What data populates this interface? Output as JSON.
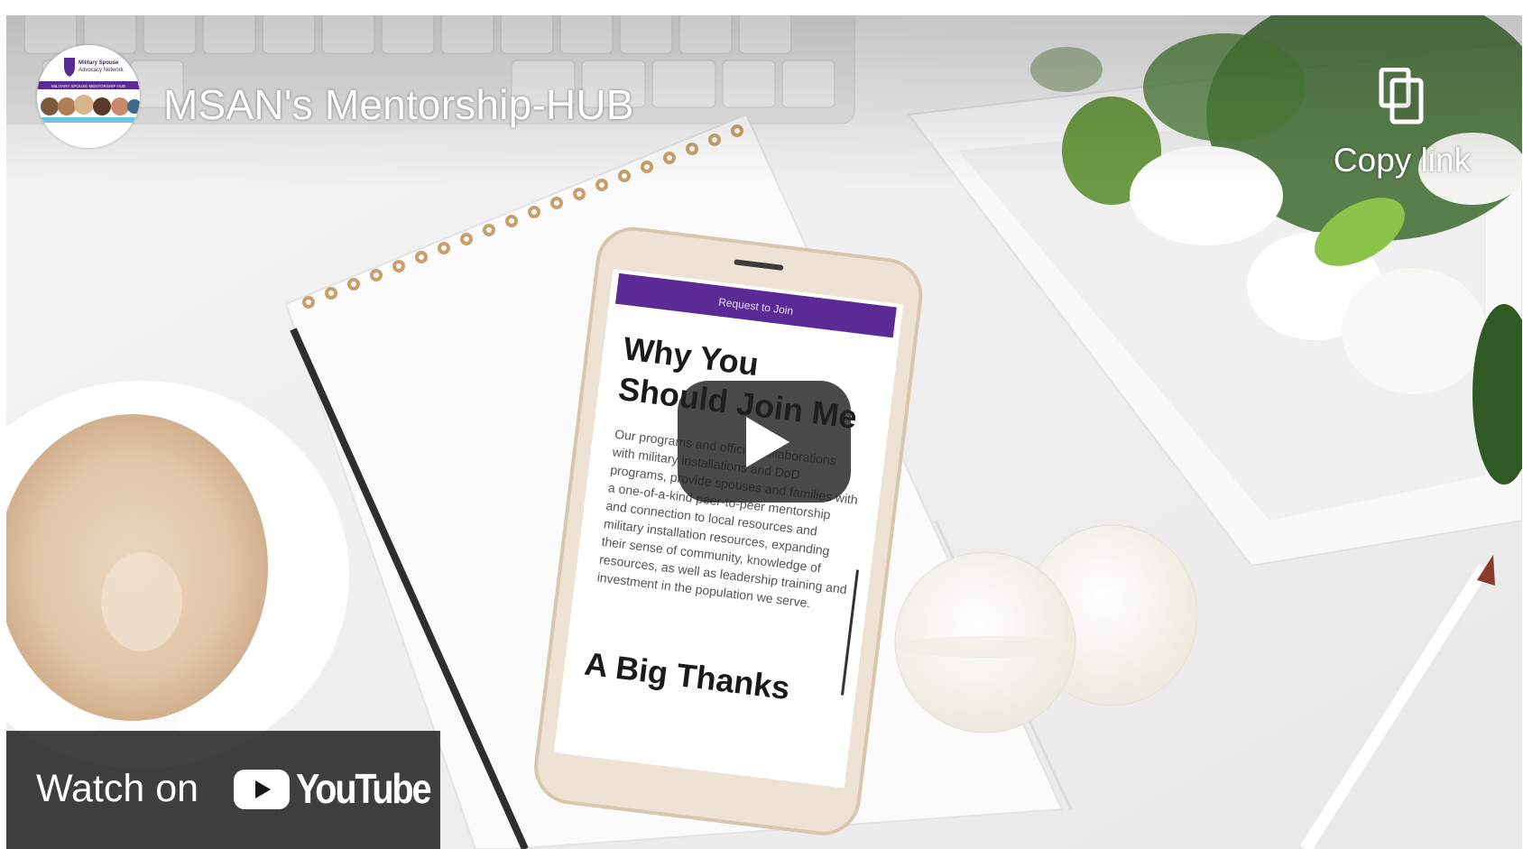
{
  "player": {
    "title": "MSAN's Mentorship-HUB",
    "copy_link_label": "Copy link",
    "watch_on_label": "Watch on",
    "youtube_wordmark": "YouTube",
    "icons": [
      "channel-avatar",
      "copy-link-icon",
      "play-icon",
      "youtube-logo-icon"
    ]
  },
  "thumbnail": {
    "phone_banner": "Request to Join",
    "heading_1": "Why You",
    "heading_2": "Should Join Me",
    "body_lines": [
      "Our programs and official collaborations",
      "with military installations and DoD",
      "programs, provide spouses and families with",
      "a one-of-a-kind peer-to-peer mentorship",
      "and connection to local resources and",
      "military installation resources, expanding",
      "their sense of community, knowledge of",
      "resources, as well as leadership training and",
      "investment in the population we serve."
    ],
    "heading_3": "A Big Thanks"
  },
  "avatar": {
    "org_line_1": "Military Spouse",
    "org_line_2": "Advocacy Network",
    "band_text": "MILITARY SPOUSE MENTORSHIP HUB"
  },
  "colors": {
    "accent_purple": "#5b2a94",
    "yt_red": "#ff0000",
    "overlay_dark": "#171717"
  }
}
